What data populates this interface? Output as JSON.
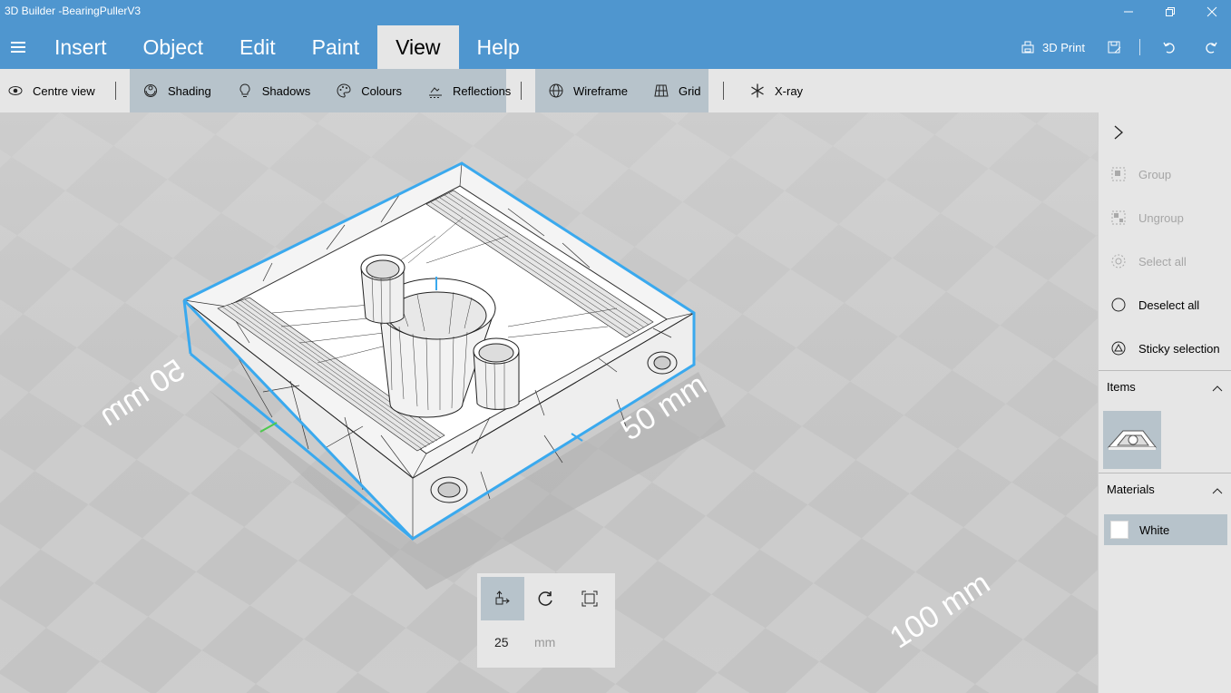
{
  "window": {
    "title": "3D Builder -BearingPullerV3",
    "minimize_icon": "minimize-icon",
    "restore_icon": "restore-icon",
    "close_icon": "close-icon"
  },
  "menu": {
    "tabs": [
      "Insert",
      "Object",
      "Edit",
      "Paint",
      "View",
      "Help"
    ],
    "active_tab": "View",
    "print_label": "3D Print"
  },
  "toolbar": {
    "centre_view": "Centre view",
    "shading": "Shading",
    "shadows": "Shadows",
    "colours": "Colours",
    "reflections": "Reflections",
    "wireframe": "Wireframe",
    "grid": "Grid",
    "xray": "X-ray"
  },
  "viewport": {
    "dims": {
      "left": "50 mm",
      "right": "50 mm",
      "far": "100 mm"
    },
    "accent_color": "#3aa9ee"
  },
  "transform": {
    "value": "25",
    "unit": "mm"
  },
  "side_panel": {
    "group": "Group",
    "ungroup": "Ungroup",
    "select_all": "Select all",
    "deselect_all": "Deselect all",
    "sticky_selection": "Sticky selection",
    "items_header": "Items",
    "materials_header": "Materials",
    "material_name": "White"
  },
  "colors": {
    "titlebar": "#4f96cf",
    "toolbar": "#e6e6e6",
    "selected": "#b7c3cb"
  }
}
